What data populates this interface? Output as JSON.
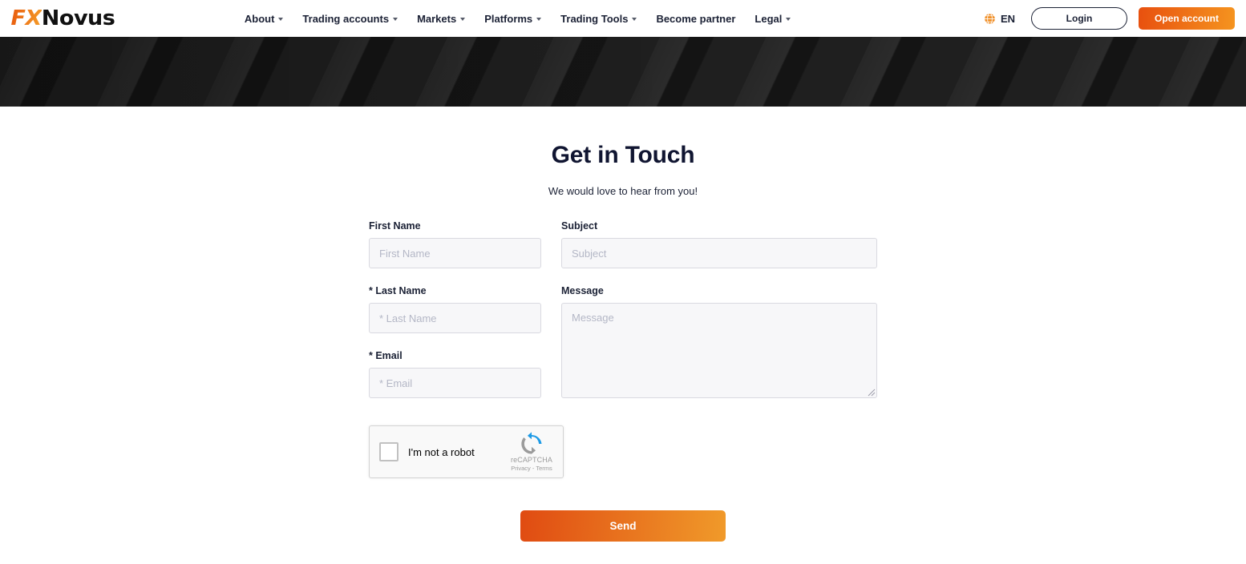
{
  "header": {
    "logo": {
      "part1": "FX",
      "part2": "Novus",
      "name": "fxnovus-logo"
    },
    "nav_items": [
      {
        "label": "About",
        "has_caret": true
      },
      {
        "label": "Trading accounts",
        "has_caret": true
      },
      {
        "label": "Markets",
        "has_caret": true
      },
      {
        "label": "Platforms",
        "has_caret": true
      },
      {
        "label": "Trading Tools",
        "has_caret": true
      },
      {
        "label": "Become partner",
        "has_caret": false
      },
      {
        "label": "Legal",
        "has_caret": true
      }
    ],
    "language": {
      "icon": "globe-icon",
      "label": "EN"
    },
    "login_label": "Login",
    "open_account_label": "Open account"
  },
  "main": {
    "title": "Get in Touch",
    "subtitle": "We would love to hear from you!",
    "fields": {
      "first_name": {
        "label": "First Name",
        "placeholder": "First Name",
        "value": ""
      },
      "last_name": {
        "label": "* Last Name",
        "placeholder": "* Last Name",
        "value": ""
      },
      "email": {
        "label": "* Email",
        "placeholder": "* Email",
        "value": ""
      },
      "subject": {
        "label": "Subject",
        "placeholder": "Subject",
        "value": ""
      },
      "message": {
        "label": "Message",
        "placeholder": "Message",
        "value": ""
      }
    },
    "recaptcha": {
      "label": "I'm not a robot",
      "brand": "reCAPTCHA",
      "links": "Privacy - Terms"
    },
    "send_label": "Send"
  },
  "colors": {
    "brand_orange_dark": "#e04b12",
    "brand_orange_light": "#f09a2a",
    "text_dark": "#1b2135",
    "banner_dark": "#1f1f1f",
    "input_bg": "#f7f7f9",
    "input_border": "#d9d9e0"
  }
}
